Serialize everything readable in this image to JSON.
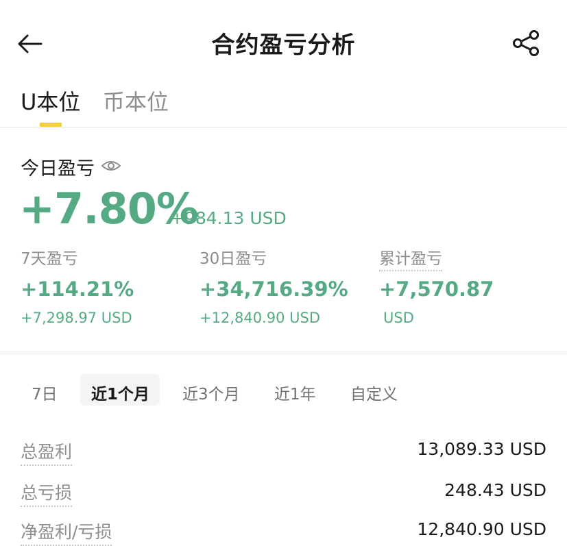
{
  "header": {
    "title": "合约盈亏分析"
  },
  "tabs": [
    {
      "label": "U本位",
      "active": true
    },
    {
      "label": "币本位",
      "active": false
    }
  ],
  "today": {
    "label": "今日盈亏",
    "percent": "+7.80%",
    "usd": "+984.13 USD"
  },
  "stats": [
    {
      "label": "7天盈亏",
      "percent": "+114.21%",
      "usd": "+7,298.97 USD"
    },
    {
      "label": "30日盈亏",
      "percent": "+34,716.39%",
      "usd": "+12,840.90 USD"
    },
    {
      "label": "累计盈亏",
      "percent": "+7,570.87",
      "usd": "USD"
    }
  ],
  "periods": [
    {
      "label": "7日",
      "active": false
    },
    {
      "label": "近1个月",
      "active": true
    },
    {
      "label": "近3个月",
      "active": false
    },
    {
      "label": "近1年",
      "active": false
    },
    {
      "label": "自定义",
      "active": false
    }
  ],
  "summary": [
    {
      "label": "总盈利",
      "value": "13,089.33 USD"
    },
    {
      "label": "总亏损",
      "value": "248.43 USD"
    },
    {
      "label": "净盈利/亏损",
      "value": "12,840.90 USD"
    }
  ],
  "colors": {
    "profit_green": "#55aa84",
    "tab_indicator": "#f2d233"
  },
  "icons": {
    "back": "arrow-left-icon",
    "share": "share-icon",
    "visibility": "eye-icon"
  }
}
